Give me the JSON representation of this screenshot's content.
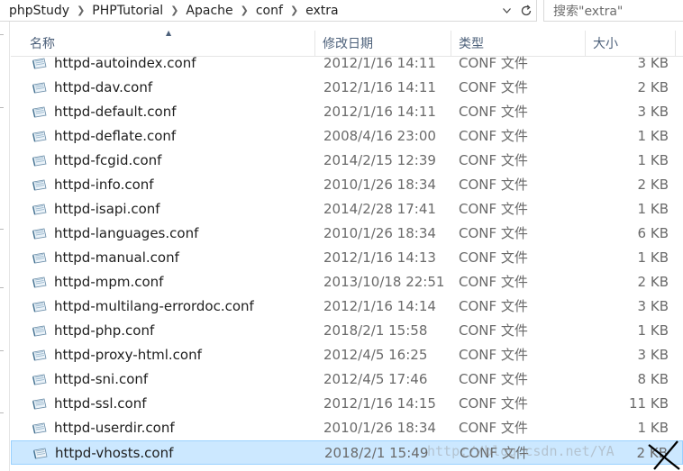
{
  "breadcrumb": [
    "phpStudy",
    "PHPTutorial",
    "Apache",
    "conf",
    "extra"
  ],
  "search": {
    "placeholder": "搜索\"extra\""
  },
  "columns": {
    "name": "名称",
    "date": "修改日期",
    "type": "类型",
    "size": "大小"
  },
  "files": [
    {
      "name": "httpd-autoindex.conf",
      "date": "2012/1/16 14:11",
      "type": "CONF 文件",
      "size": "3 KB"
    },
    {
      "name": "httpd-dav.conf",
      "date": "2012/1/16 14:11",
      "type": "CONF 文件",
      "size": "2 KB"
    },
    {
      "name": "httpd-default.conf",
      "date": "2012/1/16 14:11",
      "type": "CONF 文件",
      "size": "3 KB"
    },
    {
      "name": "httpd-deflate.conf",
      "date": "2008/4/16 23:00",
      "type": "CONF 文件",
      "size": "1 KB"
    },
    {
      "name": "httpd-fcgid.conf",
      "date": "2014/2/15 12:39",
      "type": "CONF 文件",
      "size": "1 KB"
    },
    {
      "name": "httpd-info.conf",
      "date": "2010/1/26 18:34",
      "type": "CONF 文件",
      "size": "2 KB"
    },
    {
      "name": "httpd-isapi.conf",
      "date": "2014/2/28 17:41",
      "type": "CONF 文件",
      "size": "1 KB"
    },
    {
      "name": "httpd-languages.conf",
      "date": "2010/1/26 18:34",
      "type": "CONF 文件",
      "size": "6 KB"
    },
    {
      "name": "httpd-manual.conf",
      "date": "2012/1/16 14:13",
      "type": "CONF 文件",
      "size": "1 KB"
    },
    {
      "name": "httpd-mpm.conf",
      "date": "2013/10/18 22:51",
      "type": "CONF 文件",
      "size": "2 KB"
    },
    {
      "name": "httpd-multilang-errordoc.conf",
      "date": "2012/1/16 14:14",
      "type": "CONF 文件",
      "size": "3 KB"
    },
    {
      "name": "httpd-php.conf",
      "date": "2018/2/1 15:58",
      "type": "CONF 文件",
      "size": "1 KB"
    },
    {
      "name": "httpd-proxy-html.conf",
      "date": "2012/4/5 16:25",
      "type": "CONF 文件",
      "size": "3 KB"
    },
    {
      "name": "httpd-sni.conf",
      "date": "2012/4/5 17:46",
      "type": "CONF 文件",
      "size": "8 KB"
    },
    {
      "name": "httpd-ssl.conf",
      "date": "2012/1/16 14:15",
      "type": "CONF 文件",
      "size": "11 KB"
    },
    {
      "name": "httpd-userdir.conf",
      "date": "2010/1/26 18:34",
      "type": "CONF 文件",
      "size": "1 KB"
    },
    {
      "name": "httpd-vhosts.conf",
      "date": "2018/2/1 15:49",
      "type": "CONF 文件",
      "size": "2 KB",
      "selected": true
    }
  ],
  "watermark": "http://blog.csdn.net/YA",
  "colors": {
    "selection_bg": "#cce8ff",
    "selection_border": "#99d1ff",
    "header_text": "#4c607a"
  }
}
